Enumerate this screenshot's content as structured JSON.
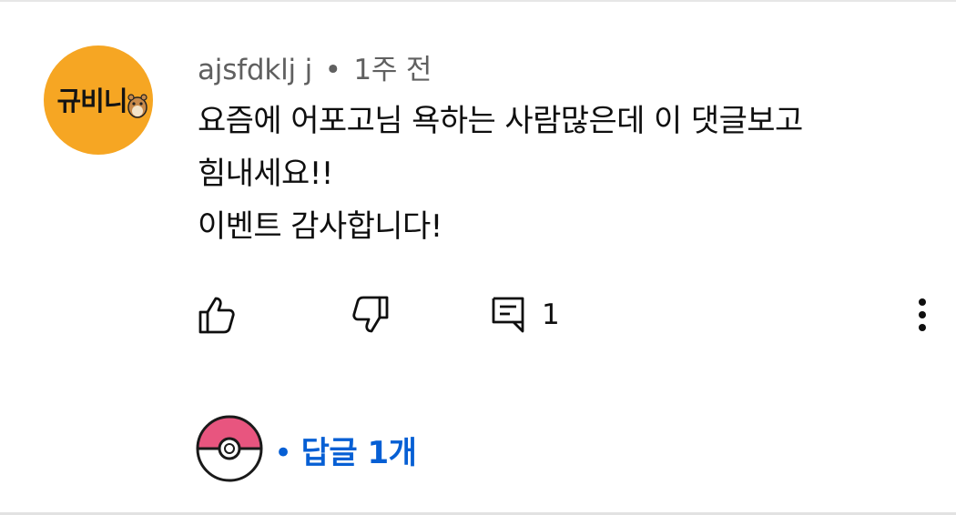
{
  "comment": {
    "author": "ajsfdklj j",
    "separator": "•",
    "time": "1주 전",
    "avatar_text": "규비니",
    "lines": [
      "요즘에 어포고님 욕하는 사람많은데 이 댓글보고",
      "힘내세요!!",
      "이벤트 감사합니다!"
    ]
  },
  "actions": {
    "like_icon": "thumbs-up-icon",
    "dislike_icon": "thumbs-down-icon",
    "reply_icon": "reply-comment-icon",
    "reply_count": "1",
    "more_icon": "more-vert-icon"
  },
  "replies": {
    "separator": "•",
    "label": "답글 1개",
    "avatar_icon": "pokeball-icon"
  },
  "colors": {
    "avatar_bg": "#f6a623",
    "link": "#065fd4",
    "meta": "#606060",
    "pokeball_top": "#e8557f"
  }
}
